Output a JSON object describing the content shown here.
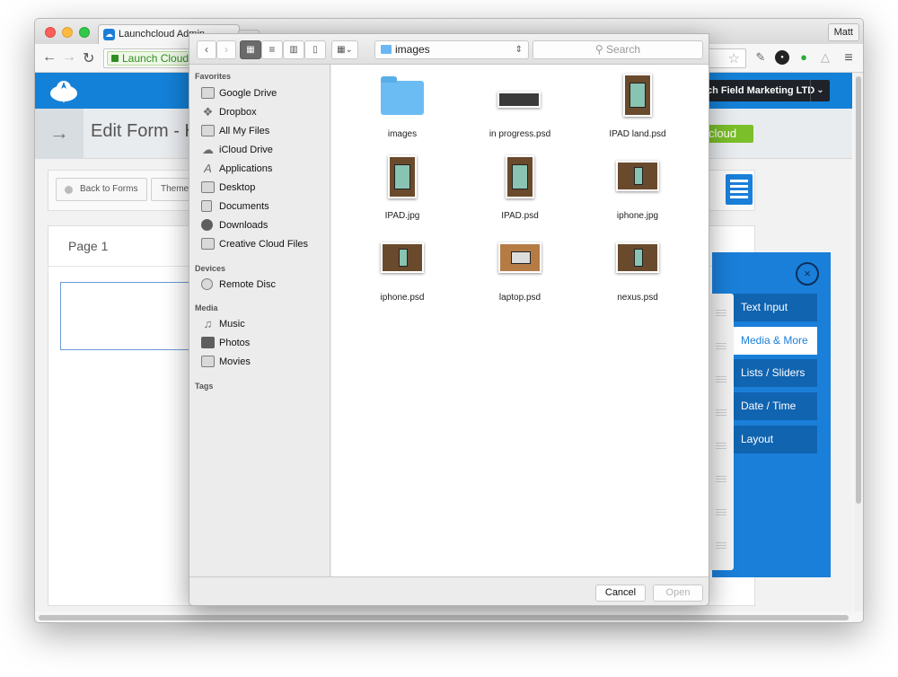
{
  "browser": {
    "tab_title": "Launchcloud Admin",
    "user_button": "Matt",
    "omnibox_chip": "Launch Cloud"
  },
  "app": {
    "company_selector": "ch Field Marketing LTD",
    "page_heading": "Edit Form - H",
    "cloud_badge": "cloud",
    "back_button": "Back to Forms",
    "theme_button": "Theme",
    "page_tab": "Page 1",
    "palette_close": "×",
    "palette_items": [
      {
        "label": "Text Input"
      },
      {
        "label": "Media & More"
      },
      {
        "label": "Lists / Sliders"
      },
      {
        "label": "Date / Time"
      },
      {
        "label": "Layout"
      }
    ],
    "active_palette_item": "Media & More"
  },
  "dialog": {
    "path": "images",
    "search_placeholder": "Search",
    "sidebar": {
      "favorites_label": "Favorites",
      "favorites": [
        "Google Drive",
        "Dropbox",
        "All My Files",
        "iCloud Drive",
        "Applications",
        "Desktop",
        "Documents",
        "Downloads",
        "Creative Cloud Files"
      ],
      "devices_label": "Devices",
      "devices": [
        "Remote Disc"
      ],
      "media_label": "Media",
      "media": [
        "Music",
        "Photos",
        "Movies"
      ],
      "tags_label": "Tags"
    },
    "files": [
      "images",
      "in progress.psd",
      "IPAD land.psd",
      "IPAD.jpg",
      "IPAD.psd",
      "iphone.jpg",
      "iphone.psd",
      "laptop.psd",
      "nexus.psd"
    ],
    "cancel_label": "Cancel",
    "open_label": "Open",
    "icons": {
      "back": "chevron-left-icon",
      "forward": "chevron-right-icon",
      "view_icons": "icon-view-icon",
      "view_list": "list-view-icon",
      "view_columns": "column-view-icon",
      "view_cover": "cover-flow-icon",
      "arrange": "arrange-icon"
    }
  },
  "colors": {
    "brand_blue": "#1481d8",
    "palette_blue": "#1a7fd9",
    "badge_green": "#7bbf2a",
    "company_bg": "#1f2329"
  }
}
